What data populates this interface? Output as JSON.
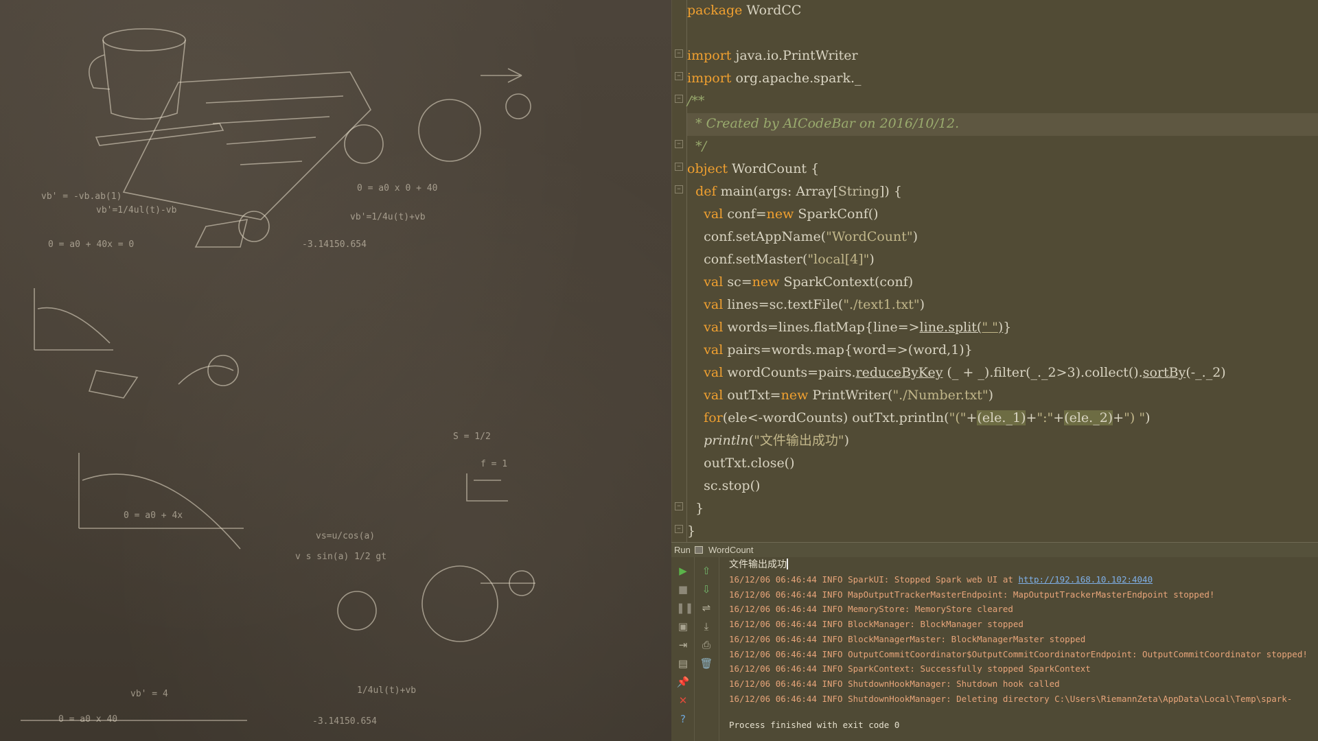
{
  "editor": {
    "lines": [
      {
        "parts": [
          {
            "t": "package",
            "c": "kw"
          },
          {
            "t": " WordCC"
          }
        ]
      },
      {
        "parts": []
      },
      {
        "parts": [
          {
            "t": "import",
            "c": "kw"
          },
          {
            "t": " java.io.PrintWriter"
          }
        ]
      },
      {
        "parts": [
          {
            "t": "import",
            "c": "kw"
          },
          {
            "t": " org.apache.spark._"
          }
        ]
      },
      {
        "parts": [
          {
            "t": "/**",
            "c": "cmt"
          }
        ]
      },
      {
        "parts": [
          {
            "t": "  * Created by AICodeBar on 2016/10/12.",
            "c": "cmt"
          }
        ],
        "current": true
      },
      {
        "parts": [
          {
            "t": "  */",
            "c": "cmt"
          }
        ]
      },
      {
        "parts": [
          {
            "t": "object",
            "c": "kw"
          },
          {
            "t": " WordCount {"
          }
        ]
      },
      {
        "parts": [
          {
            "t": "  "
          },
          {
            "t": "def",
            "c": "kw"
          },
          {
            "t": " main(args: Array["
          },
          {
            "t": "String",
            "c": "type"
          },
          {
            "t": "]) {"
          }
        ]
      },
      {
        "parts": [
          {
            "t": "    "
          },
          {
            "t": "val",
            "c": "kw"
          },
          {
            "t": " conf="
          },
          {
            "t": "new",
            "c": "kw"
          },
          {
            "t": " SparkConf()"
          }
        ]
      },
      {
        "parts": [
          {
            "t": "    conf.setAppName("
          },
          {
            "t": "\"WordCount\"",
            "c": "str"
          },
          {
            "t": ")"
          }
        ]
      },
      {
        "parts": [
          {
            "t": "    conf.setMaster("
          },
          {
            "t": "\"local[4]\"",
            "c": "str"
          },
          {
            "t": ")"
          }
        ]
      },
      {
        "parts": [
          {
            "t": "    "
          },
          {
            "t": "val",
            "c": "kw"
          },
          {
            "t": " sc="
          },
          {
            "t": "new",
            "c": "kw"
          },
          {
            "t": " SparkContext(conf)"
          }
        ]
      },
      {
        "parts": [
          {
            "t": "    "
          },
          {
            "t": "val",
            "c": "kw"
          },
          {
            "t": " lines=sc.textFile("
          },
          {
            "t": "\"./text1.txt\"",
            "c": "str"
          },
          {
            "t": ")"
          }
        ]
      },
      {
        "parts": [
          {
            "t": "    "
          },
          {
            "t": "val",
            "c": "kw"
          },
          {
            "t": " words=lines.flatMap{line=>"
          },
          {
            "t": "line.split(",
            "c": "ul"
          },
          {
            "t": "\" \"",
            "c": "str ul"
          },
          {
            "t": ")",
            "c": "ul"
          },
          {
            "t": "}"
          }
        ]
      },
      {
        "parts": [
          {
            "t": "    "
          },
          {
            "t": "val",
            "c": "kw"
          },
          {
            "t": " pairs=words.map{word=>(word,1)}"
          }
        ]
      },
      {
        "parts": [
          {
            "t": "    "
          },
          {
            "t": "val",
            "c": "kw"
          },
          {
            "t": " wordCounts=pairs."
          },
          {
            "t": "reduceByKey",
            "c": "ul"
          },
          {
            "t": " (_ + _).filter(_._2>3).collect()."
          },
          {
            "t": "sortBy",
            "c": "ul"
          },
          {
            "t": "(-_._2)"
          }
        ]
      },
      {
        "parts": [
          {
            "t": "    "
          },
          {
            "t": "val",
            "c": "kw"
          },
          {
            "t": " outTxt="
          },
          {
            "t": "new",
            "c": "kw"
          },
          {
            "t": " PrintWriter("
          },
          {
            "t": "\"./Number.txt\"",
            "c": "str"
          },
          {
            "t": ")"
          }
        ]
      },
      {
        "parts": [
          {
            "t": "    "
          },
          {
            "t": "for",
            "c": "kw"
          },
          {
            "t": "(ele<-wordCounts) outTxt.println("
          },
          {
            "t": "\"(\"",
            "c": "str"
          },
          {
            "t": "+"
          },
          {
            "t": "(ele._1)",
            "c": "hl"
          },
          {
            "t": "+"
          },
          {
            "t": "\":\"",
            "c": "str"
          },
          {
            "t": "+"
          },
          {
            "t": "(ele._2)",
            "c": "hl"
          },
          {
            "t": "+"
          },
          {
            "t": "\") \"",
            "c": "str"
          },
          {
            "t": ")"
          }
        ]
      },
      {
        "parts": [
          {
            "t": "    "
          },
          {
            "t": "println",
            "c": "ital"
          },
          {
            "t": "("
          },
          {
            "t": "\"文件输出成功\"",
            "c": "str"
          },
          {
            "t": ")"
          }
        ]
      },
      {
        "parts": [
          {
            "t": "    outTxt.close()"
          }
        ]
      },
      {
        "parts": [
          {
            "t": "    sc.stop()"
          }
        ]
      },
      {
        "parts": [
          {
            "t": "  }"
          }
        ]
      },
      {
        "parts": [
          {
            "t": "}"
          }
        ]
      }
    ]
  },
  "run_panel": {
    "label": "Run",
    "tab_name": "WordCount",
    "output_first_line": "文件输出成功",
    "log_lines": [
      {
        "prefix": "16/12/06 06:46:44 INFO SparkUI: Stopped Spark web UI at ",
        "link": "http://192.168.10.102:4040"
      },
      {
        "prefix": "16/12/06 06:46:44 INFO MapOutputTrackerMasterEndpoint: MapOutputTrackerMasterEndpoint stopped!"
      },
      {
        "prefix": "16/12/06 06:46:44 INFO MemoryStore: MemoryStore cleared"
      },
      {
        "prefix": "16/12/06 06:46:44 INFO BlockManager: BlockManager stopped"
      },
      {
        "prefix": "16/12/06 06:46:44 INFO BlockManagerMaster: BlockManagerMaster stopped"
      },
      {
        "prefix": "16/12/06 06:46:44 INFO OutputCommitCoordinator$OutputCommitCoordinatorEndpoint: OutputCommitCoordinator stopped!"
      },
      {
        "prefix": "16/12/06 06:46:44 INFO SparkContext: Successfully stopped SparkContext"
      },
      {
        "prefix": "16/12/06 06:46:44 INFO ShutdownHookManager: Shutdown hook called"
      },
      {
        "prefix": "16/12/06 06:46:44 INFO ShutdownHookManager: Deleting directory C:\\Users\\RiemannZeta\\AppData\\Local\\Temp\\spark-"
      }
    ],
    "finish_message": "Process finished with exit code 0",
    "toolbar_left": [
      {
        "icon": "run-icon",
        "glyph": "▶",
        "color": "#5bb34a"
      },
      {
        "icon": "stop-icon",
        "glyph": "■",
        "color": "#8d8878"
      },
      {
        "icon": "pause-icon",
        "glyph": "❚❚",
        "color": "#8d8878"
      },
      {
        "icon": "dump-threads-icon",
        "glyph": "▣",
        "color": "#a8a390"
      },
      {
        "icon": "exit-icon",
        "glyph": "⇥",
        "color": "#b6b19c"
      },
      {
        "icon": "layout-icon",
        "glyph": "▤",
        "color": "#b6b19c"
      },
      {
        "icon": "pin-icon",
        "glyph": "📌",
        "color": "#c96a5c"
      },
      {
        "icon": "close-icon",
        "glyph": "✕",
        "color": "#e04a3a"
      },
      {
        "icon": "help-icon",
        "glyph": "?",
        "color": "#6ea6d8"
      }
    ],
    "toolbar_right": [
      {
        "icon": "up-arrow-icon",
        "glyph": "⇧",
        "color": "#72b56a"
      },
      {
        "icon": "down-arrow-icon",
        "glyph": "⇩",
        "color": "#72b56a"
      },
      {
        "icon": "soft-wrap-icon",
        "glyph": "⇌",
        "color": "#b6b19c"
      },
      {
        "icon": "scroll-to-end-icon",
        "glyph": "⤓",
        "color": "#b6b19c"
      },
      {
        "icon": "print-icon",
        "glyph": "⎙",
        "color": "#b6b19c"
      },
      {
        "icon": "clear-icon",
        "glyph": "🗑",
        "color": "#8fb4c6"
      }
    ]
  }
}
